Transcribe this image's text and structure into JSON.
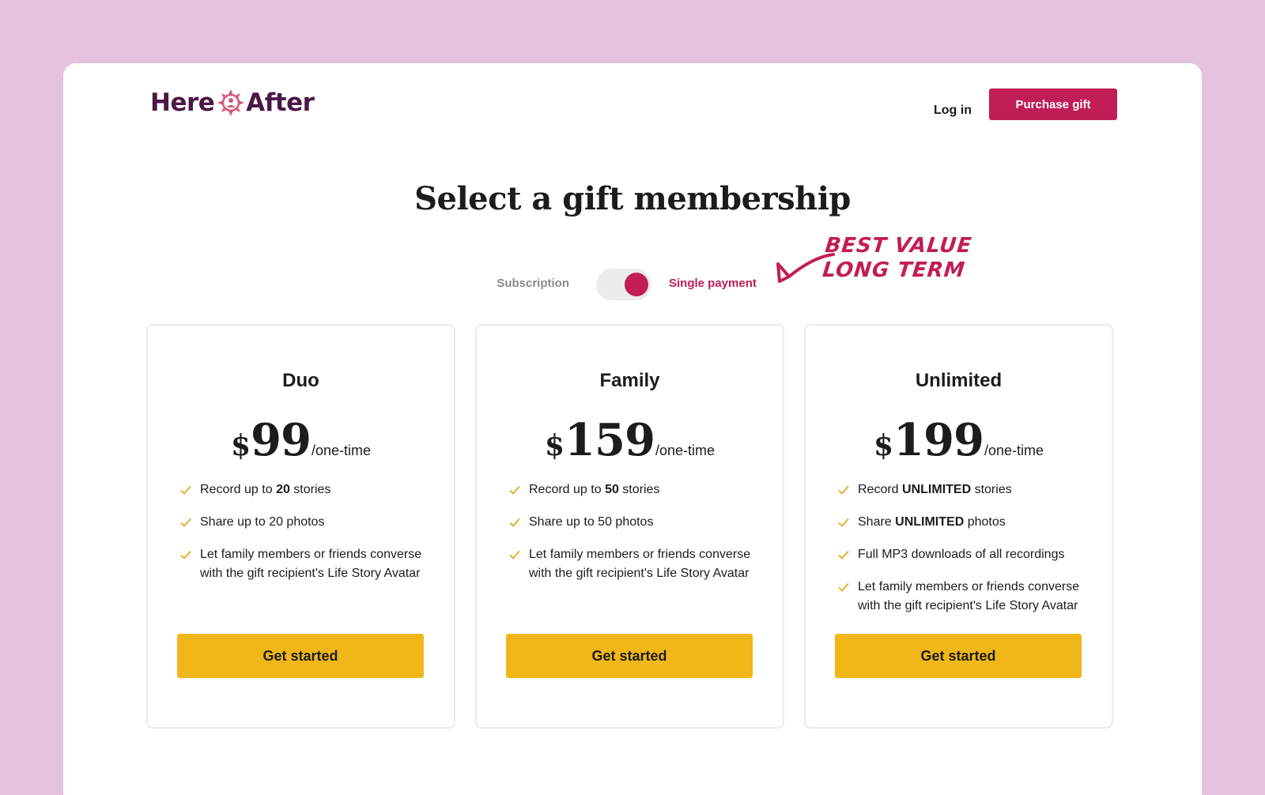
{
  "brand": {
    "name_left": "Here",
    "name_right": "After",
    "logo_icon": "sun-person-icon",
    "primary_color": "#4b1747",
    "accent_color": "#c11d56",
    "cta_color": "#f1b719",
    "background_color": "#e6c3dc"
  },
  "nav": {
    "login_label": "Log in",
    "purchase_label": "Purchase gift"
  },
  "page_title": "Select a gift membership",
  "billing_toggle": {
    "left_label": "Subscription",
    "right_label": "Single payment",
    "selected": "Single payment"
  },
  "annotation": {
    "line1": "BEST VALUE",
    "line2": "LONG TERM"
  },
  "plans": [
    {
      "name": "Duo",
      "currency": "$",
      "amount": "99",
      "period": "/one-time",
      "features": [
        {
          "pre": "Record up to ",
          "bold": "20",
          "post": " stories"
        },
        {
          "pre": "Share up to 20 photos",
          "bold": "",
          "post": ""
        },
        {
          "pre": "Let family members or friends converse with the gift recipient's Life Story Avatar",
          "bold": "",
          "post": ""
        }
      ],
      "cta_label": "Get started"
    },
    {
      "name": "Family",
      "currency": "$",
      "amount": "159",
      "period": "/one-time",
      "features": [
        {
          "pre": "Record up to ",
          "bold": "50",
          "post": " stories"
        },
        {
          "pre": "Share up to 50 photos",
          "bold": "",
          "post": ""
        },
        {
          "pre": "Let family members or friends converse with the gift recipient's Life Story Avatar",
          "bold": "",
          "post": ""
        }
      ],
      "cta_label": "Get started"
    },
    {
      "name": "Unlimited",
      "currency": "$",
      "amount": "199",
      "period": "/one-time",
      "features": [
        {
          "pre": "Record ",
          "bold": "UNLIMITED",
          "post": " stories"
        },
        {
          "pre": "Share ",
          "bold": "UNLIMITED",
          "post": " photos"
        },
        {
          "pre": "Full MP3 downloads of all recordings",
          "bold": "",
          "post": ""
        },
        {
          "pre": "Let family members or friends converse with the gift recipient's Life Story Avatar",
          "bold": "",
          "post": ""
        }
      ],
      "cta_label": "Get started"
    }
  ]
}
